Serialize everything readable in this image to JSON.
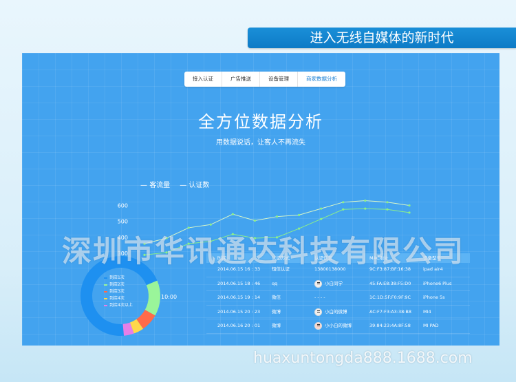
{
  "banner": {
    "title": "进入无线自媒体的新时代"
  },
  "tabs": [
    {
      "label": "接入认证",
      "active": false
    },
    {
      "label": "广告推送",
      "active": false
    },
    {
      "label": "设备管理",
      "active": false
    },
    {
      "label": "商家数据分析",
      "active": true
    }
  ],
  "hero": {
    "title": "全方位数据分析",
    "subtitle": "用数据说话，让客人不再流失"
  },
  "watermark": "深圳市华讯通达科技有限公司",
  "footer_watermark": "huaxuntongda888.1688.com",
  "colors": {
    "accent": "#1a8fd8",
    "panel": "#43a3ef",
    "line": "#8df08a"
  },
  "chart_data": [
    {
      "type": "line",
      "series": [
        {
          "name": "客流量",
          "values": [
            360,
            395,
            460,
            480,
            545,
            505,
            530,
            540,
            580,
            620,
            630,
            620,
            600
          ]
        },
        {
          "name": "认证数",
          "values": [
            290,
            305,
            360,
            375,
            420,
            395,
            400,
            455,
            515,
            575,
            580,
            575,
            555
          ]
        }
      ],
      "yticks": [
        "300",
        "400",
        "500",
        "600"
      ],
      "ylim": [
        270,
        700
      ],
      "legend_position": "top-left",
      "time_label": "10:00"
    },
    {
      "type": "pie",
      "labels": [
        "到店1次",
        "到店2次",
        "到店3次",
        "到店4次",
        "到店4次以上"
      ],
      "values": [
        68,
        14,
        7,
        4,
        4
      ],
      "colors": [
        "#1e90f0",
        "#9af59a",
        "#ff6b4a",
        "#ffd84a",
        "#e67fe8"
      ]
    }
  ],
  "table": {
    "headers": [
      "时间",
      "认证方式",
      "认证信息",
      "MAC地址",
      "设备型号"
    ],
    "rows": [
      {
        "time": "2014.06.15   16 : 33",
        "method": "短信认证",
        "info": "13800138000",
        "avatar": false,
        "mac": "9C:F3:87:BF:16:38",
        "device": "ipad air4"
      },
      {
        "time": "2014.06.15   18 : 46",
        "method": "qq",
        "info": "小白同学",
        "avatar": true,
        "mac": "45:FA:E8:38:F5:D0",
        "device": "iPhone6 Plus"
      },
      {
        "time": "2014.06.15   19 : 14",
        "method": "微信",
        "info": "- - - -",
        "avatar": false,
        "mac": "1C:1D:5F:F0:9F:9C",
        "device": "iPhone 5s"
      },
      {
        "time": "2014.06.15   20 : 23",
        "method": "微博",
        "info": "小白的微博",
        "avatar": true,
        "mac": "AC:F7:F3:A3:38:B8",
        "device": "MI4"
      },
      {
        "time": "2014.06.16   20 : 01",
        "method": "微博",
        "info": "小小白的微博",
        "avatar": true,
        "mac": "39:84:23:4A:8F:58",
        "device": "MI PAD"
      }
    ]
  }
}
